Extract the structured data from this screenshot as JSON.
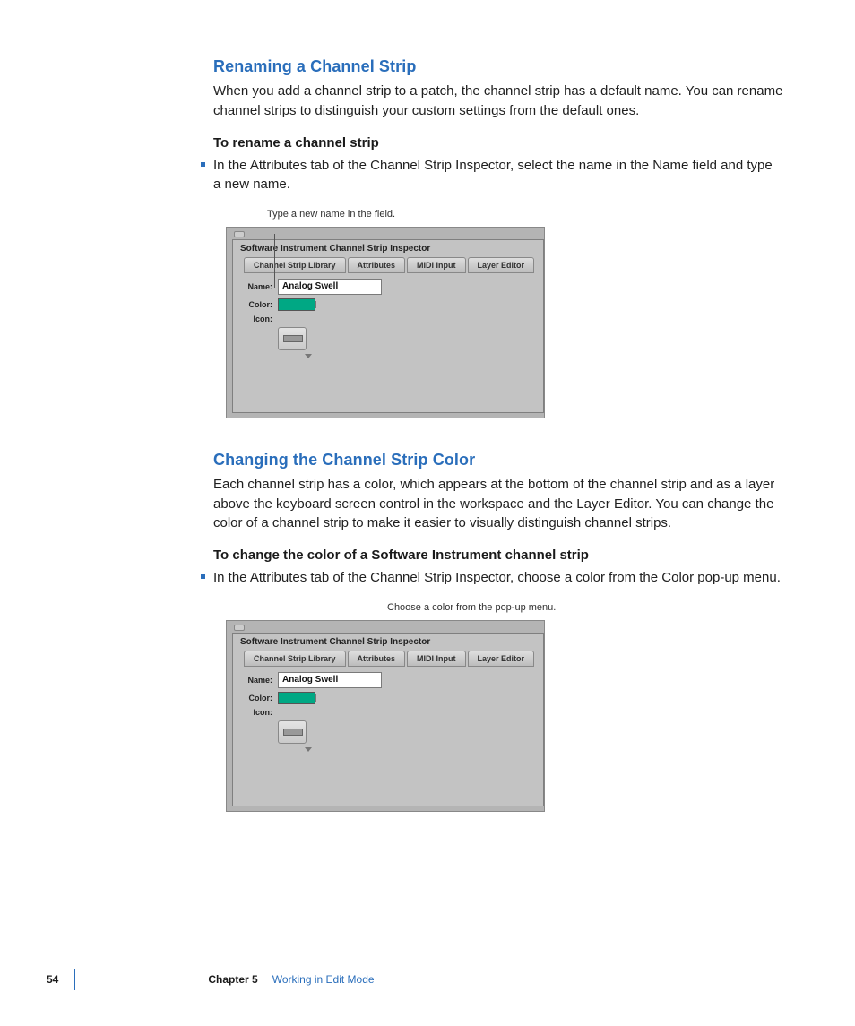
{
  "section1": {
    "heading": "Renaming a Channel Strip",
    "intro": "When you add a channel strip to a patch, the channel strip has a default name. You can rename channel strips to distinguish your custom settings from the default ones.",
    "lead": "To rename a channel strip",
    "bullet": "In the Attributes tab of the Channel Strip Inspector, select the name in the Name field and type a new name."
  },
  "figure1": {
    "callout": "Type a new name in the field.",
    "panel_title": "Software Instrument Channel Strip Inspector",
    "tabs": [
      "Channel Strip Library",
      "Attributes",
      "MIDI Input",
      "Layer Editor"
    ],
    "labels": {
      "name": "Name:",
      "color": "Color:",
      "icon": "Icon:"
    },
    "name_value": "Analog Swell",
    "color_value": "#00a884"
  },
  "section2": {
    "heading": "Changing the Channel Strip Color",
    "intro": "Each channel strip has a color, which appears at the bottom of the channel strip and as a layer above the keyboard screen control in the workspace and the Layer Editor. You can change the color of a channel strip to make it easier to visually distinguish channel strips.",
    "lead": "To change the color of a Software Instrument channel strip",
    "bullet": "In the Attributes tab of the Channel Strip Inspector, choose a color from the Color pop-up menu."
  },
  "figure2": {
    "callout": "Choose a color from the pop-up menu.",
    "panel_title": "Software Instrument Channel Strip Inspector",
    "tabs": [
      "Channel Strip Library",
      "Attributes",
      "MIDI Input",
      "Layer Editor"
    ],
    "labels": {
      "name": "Name:",
      "color": "Color:",
      "icon": "Icon:"
    },
    "name_value": "Analog Swell",
    "color_value": "#00a884"
  },
  "footer": {
    "page": "54",
    "chapter": "Chapter 5",
    "title": "Working in Edit Mode"
  }
}
